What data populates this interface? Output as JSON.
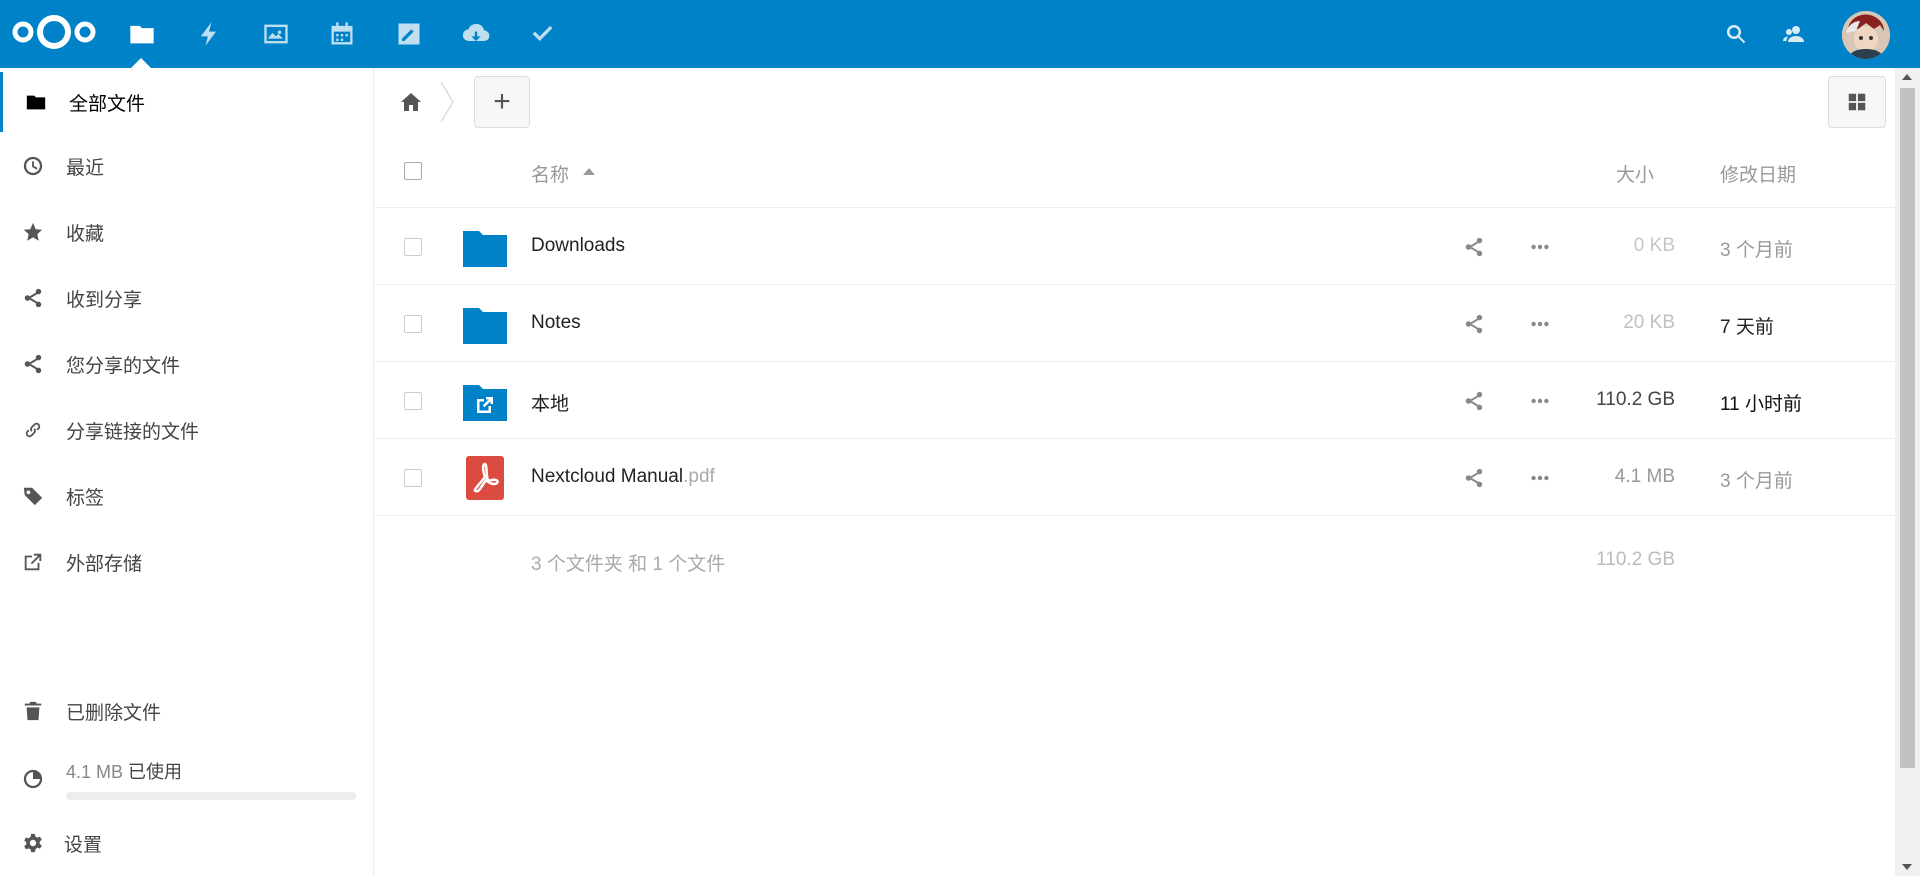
{
  "header": {
    "apps": [
      {
        "name": "files",
        "icon": "folder-icon",
        "active": true
      },
      {
        "name": "activity",
        "icon": "lightning-icon"
      },
      {
        "name": "gallery",
        "icon": "image-icon"
      },
      {
        "name": "calendar",
        "icon": "calendar-icon"
      },
      {
        "name": "notes",
        "icon": "pencil-icon"
      },
      {
        "name": "downloads",
        "icon": "cloud-download-icon"
      },
      {
        "name": "tasks",
        "icon": "checkmark-icon"
      }
    ],
    "right_icons": [
      "search-icon",
      "contacts-icon",
      "avatar"
    ],
    "accent": "#0082c9"
  },
  "nav": {
    "items": [
      {
        "label": "全部文件",
        "icon": "folder-icon",
        "active": true
      },
      {
        "label": "最近",
        "icon": "clock-icon"
      },
      {
        "label": "收藏",
        "icon": "star-icon"
      },
      {
        "label": "收到分享",
        "icon": "share-icon"
      },
      {
        "label": "您分享的文件",
        "icon": "share-icon"
      },
      {
        "label": "分享链接的文件",
        "icon": "link-icon"
      },
      {
        "label": "标签",
        "icon": "tag-icon"
      },
      {
        "label": "外部存储",
        "icon": "external-link-icon"
      }
    ],
    "trash_label": "已删除文件",
    "quota": {
      "used": "4.1 MB",
      "used_suffix": "已使用",
      "fraction": 0.0
    },
    "settings_label": "设置"
  },
  "controls": {
    "add_label": "+"
  },
  "table": {
    "headers": {
      "name": "名称",
      "size": "大小",
      "modified": "修改日期"
    },
    "rows": [
      {
        "name": "Downloads",
        "ext": "",
        "type": "folder",
        "size": "0 KB",
        "modified": "3 个月前"
      },
      {
        "name": "Notes",
        "ext": "",
        "type": "folder",
        "size": "20 KB",
        "modified": "7 天前"
      },
      {
        "name": "本地",
        "ext": "",
        "type": "external-folder",
        "size": "110.2 GB",
        "modified": "11 小时前"
      },
      {
        "name": "Nextcloud Manual",
        "ext": ".pdf",
        "type": "pdf",
        "size": "4.1 MB",
        "modified": "3 个月前"
      }
    ],
    "summary": {
      "text": "3 个文件夹 和 1 个文件",
      "size": "110.2 GB"
    }
  }
}
